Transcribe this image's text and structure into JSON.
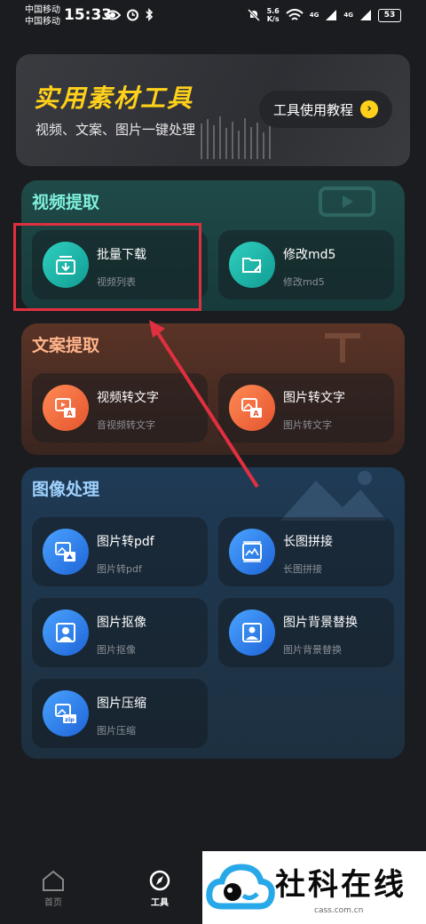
{
  "status": {
    "carrier1": "中国移动",
    "carrier2": "中国移动",
    "time": "15:33",
    "net_speed_value": "5.6",
    "net_speed_unit": "K/s",
    "signal1": "4G",
    "signal2": "4G",
    "battery": "53"
  },
  "banner": {
    "title": "实用素材工具",
    "subtitle": "视频、文案、图片一键处理",
    "tutorial_label": "工具使用教程"
  },
  "sections": {
    "video": {
      "title": "视频提取",
      "cards": [
        {
          "title": "批量下载",
          "sub": "视频列表",
          "icon": "download-icon"
        },
        {
          "title": "修改md5",
          "sub": "修改md5",
          "icon": "folder-edit-icon"
        }
      ]
    },
    "text": {
      "title": "文案提取",
      "cards": [
        {
          "title": "视频转文字",
          "sub": "音视频转文字",
          "icon": "video-to-text-icon"
        },
        {
          "title": "图片转文字",
          "sub": "图片转文字",
          "icon": "image-to-text-icon"
        }
      ]
    },
    "image": {
      "title": "图像处理",
      "cards": [
        {
          "title": "图片转pdf",
          "sub": "图片转pdf",
          "icon": "image-to-pdf-icon"
        },
        {
          "title": "长图拼接",
          "sub": "长图拼接",
          "icon": "long-image-stitch-icon"
        },
        {
          "title": "图片抠像",
          "sub": "图片抠像",
          "icon": "image-cutout-icon"
        },
        {
          "title": "图片背景替换",
          "sub": "图片背景替换",
          "icon": "background-replace-icon"
        },
        {
          "title": "图片压缩",
          "sub": "图片压缩",
          "icon": "image-compress-icon"
        }
      ]
    }
  },
  "nav": {
    "home": "首页",
    "tools": "工具"
  },
  "watermark": {
    "text": "社科在线",
    "url": "cass.com.cn"
  },
  "colors": {
    "accent_yellow": "#ffd11a",
    "highlight_red": "#e03040"
  }
}
